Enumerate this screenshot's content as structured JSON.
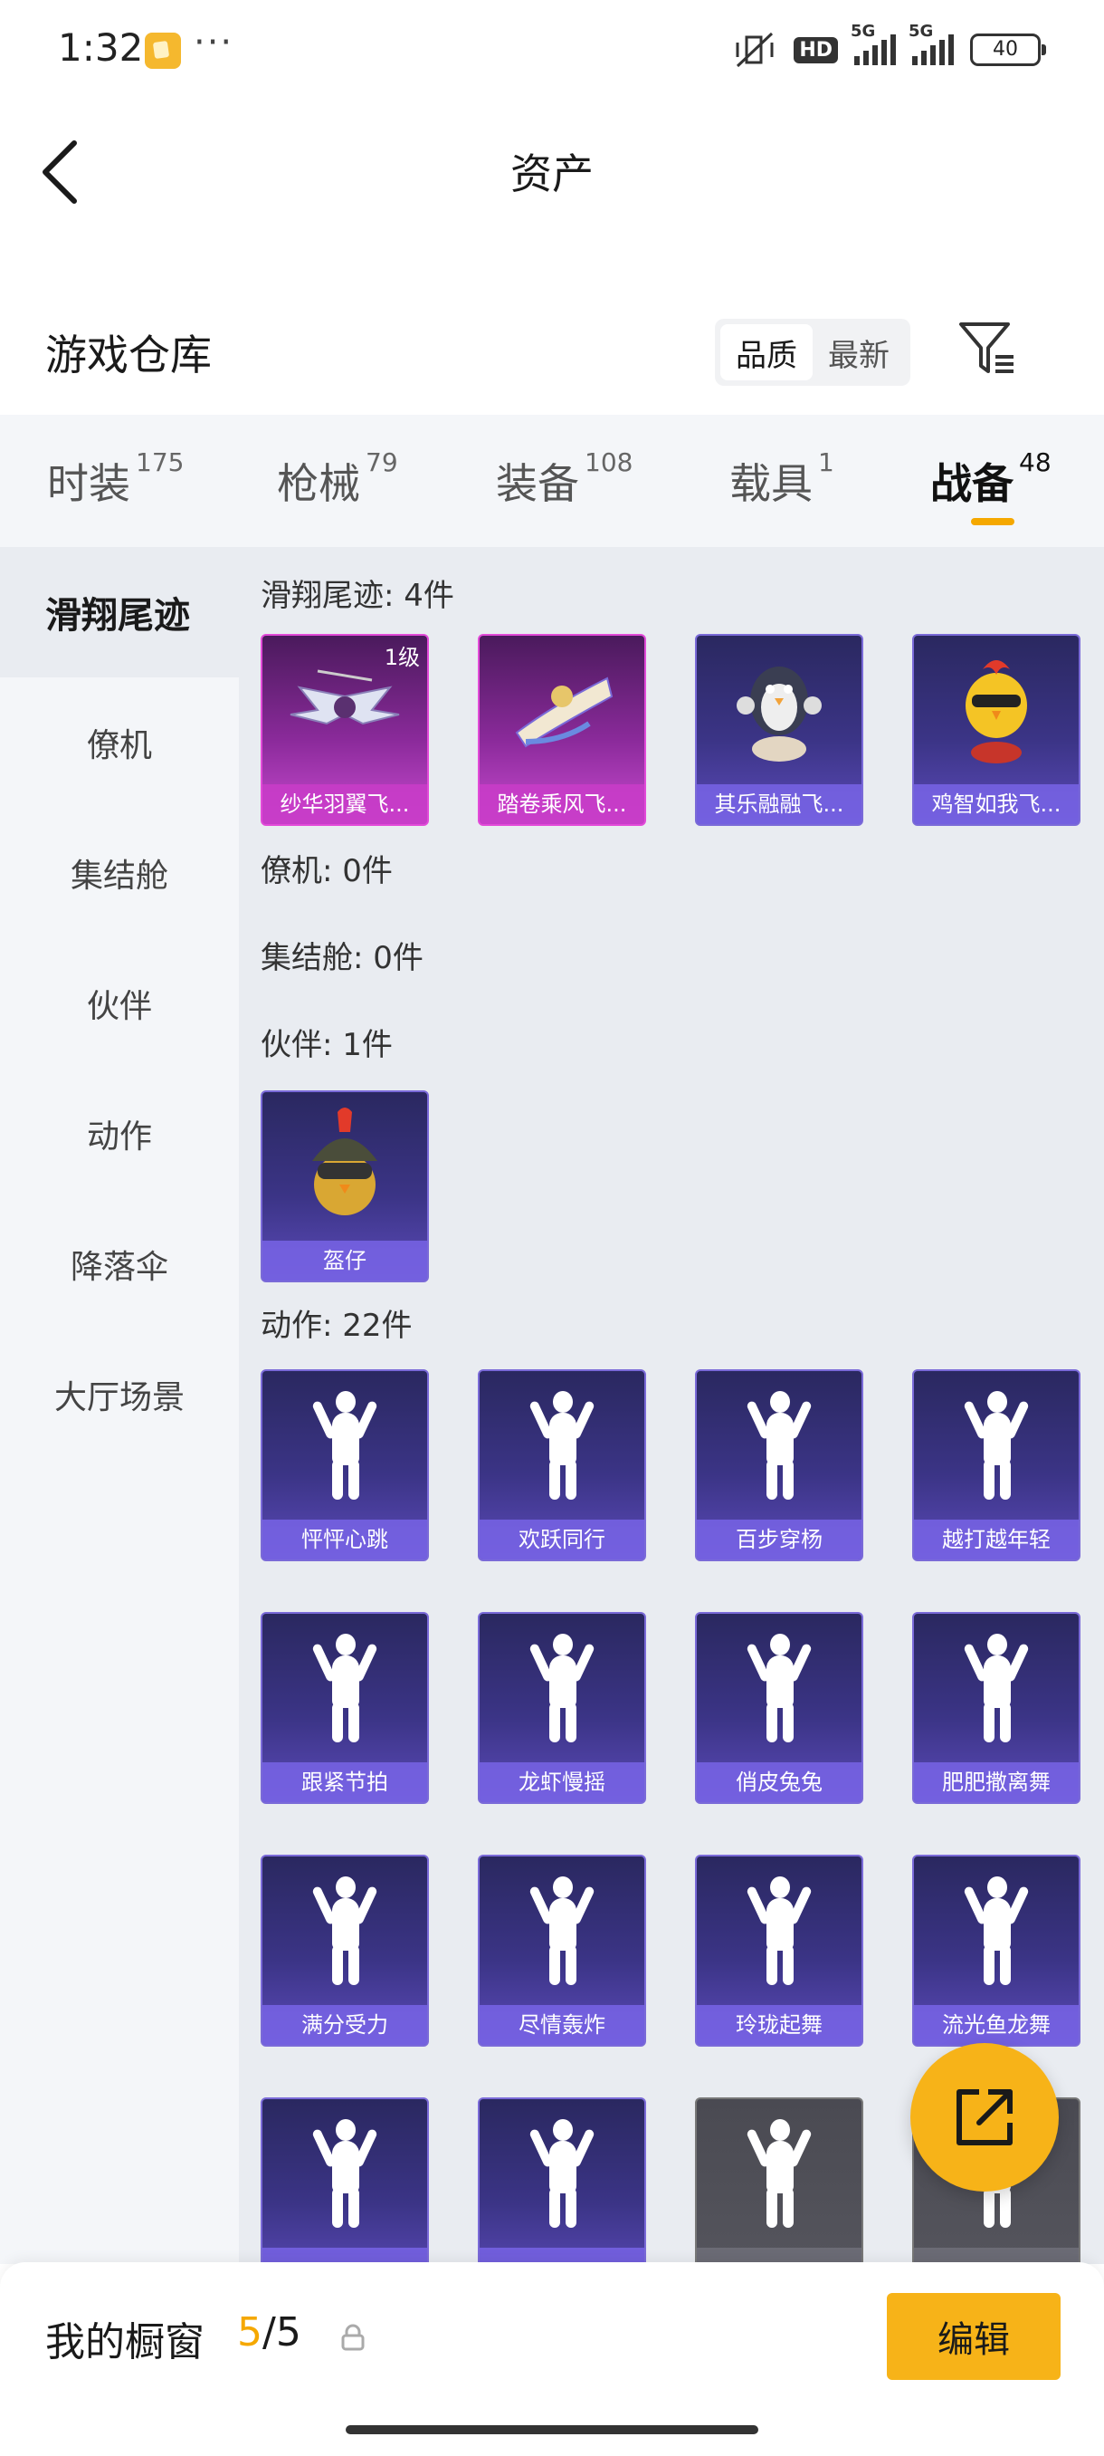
{
  "status_bar": {
    "time": "1:32",
    "dots": "···",
    "hd": "HD",
    "net1": "5G",
    "net2": "5G",
    "battery": "40"
  },
  "header": {
    "title": "资产"
  },
  "warehouse": {
    "title": "游戏仓库",
    "sort_options": [
      "品质",
      "最新"
    ],
    "active_sort": "品质"
  },
  "tabs": [
    {
      "label": "时装",
      "count": "175"
    },
    {
      "label": "枪械",
      "count": "79"
    },
    {
      "label": "装备",
      "count": "108"
    },
    {
      "label": "载具",
      "count": "1"
    },
    {
      "label": "战备",
      "count": "48"
    }
  ],
  "active_tab": "战备",
  "sidebar": {
    "items": [
      "滑翔尾迹",
      "僚机",
      "集结舱",
      "伙伴",
      "动作",
      "降落伞",
      "大厅场景"
    ],
    "active": "滑翔尾迹"
  },
  "sections": {
    "glide": {
      "title": "滑翔尾迹: 4件",
      "items": [
        {
          "name": "纱华羽翼飞...",
          "level": "1级"
        },
        {
          "name": "踏卷乘风飞..."
        },
        {
          "name": "其乐融融飞..."
        },
        {
          "name": "鸡智如我飞..."
        }
      ]
    },
    "wingman": {
      "title": "僚机: 0件"
    },
    "pod": {
      "title": "集结舱: 0件"
    },
    "partner": {
      "title": "伙伴: 1件",
      "items": [
        {
          "name": "盔仔"
        }
      ]
    },
    "emote": {
      "title": "动作: 22件",
      "items": [
        {
          "name": "怦怦心跳"
        },
        {
          "name": "欢跃同行"
        },
        {
          "name": "百步穿杨"
        },
        {
          "name": "越打越年轻"
        },
        {
          "name": "跟紧节拍"
        },
        {
          "name": "龙虾慢摇"
        },
        {
          "name": "俏皮兔兔"
        },
        {
          "name": "肥肥撒离舞"
        },
        {
          "name": "满分受力"
        },
        {
          "name": "尽情轰炸"
        },
        {
          "name": "玲珑起舞"
        },
        {
          "name": "流光鱼龙舞"
        },
        {
          "name": ""
        },
        {
          "name": ""
        },
        {
          "name": ""
        },
        {
          "name": ""
        }
      ]
    }
  },
  "bottom": {
    "window_label": "我的橱窗",
    "window_current": "5",
    "window_total": "/5",
    "edit_label": "编辑"
  },
  "colors": {
    "accent": "#f7b318",
    "card_purple": "#3b3486",
    "card_pink": "#8a2a9a"
  }
}
